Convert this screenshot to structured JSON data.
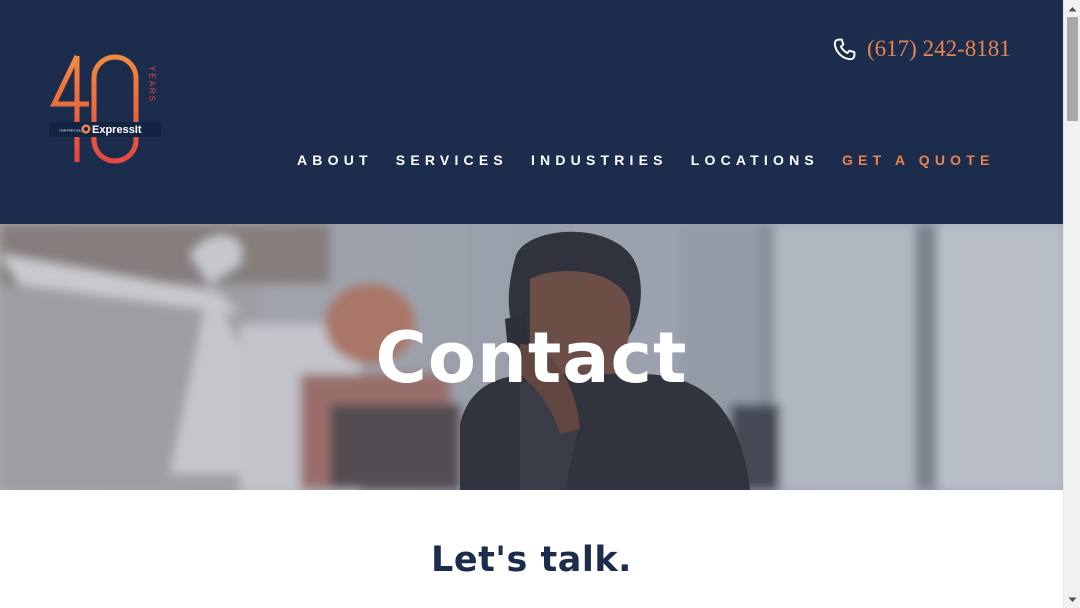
{
  "header": {
    "logo": {
      "number": "40",
      "years_label": "YEARS",
      "brand": "ExpressIt",
      "tagline": "YOUR PRINT SOLUTION",
      "icon": "expressit-logo"
    },
    "phone": {
      "icon": "phone-icon",
      "number": "(617) 242-8181"
    },
    "nav": [
      {
        "label": "ABOUT"
      },
      {
        "label": "SERVICES"
      },
      {
        "label": "INDUSTRIES"
      },
      {
        "label": "LOCATIONS"
      },
      {
        "label": "GET A QUOTE"
      }
    ]
  },
  "hero": {
    "title": "Contact"
  },
  "main": {
    "heading": "Let's talk."
  },
  "colors": {
    "navy": "#1c2c4d",
    "accent": "#e8834f",
    "logo_red": "#e4483f",
    "white": "#ffffff"
  }
}
